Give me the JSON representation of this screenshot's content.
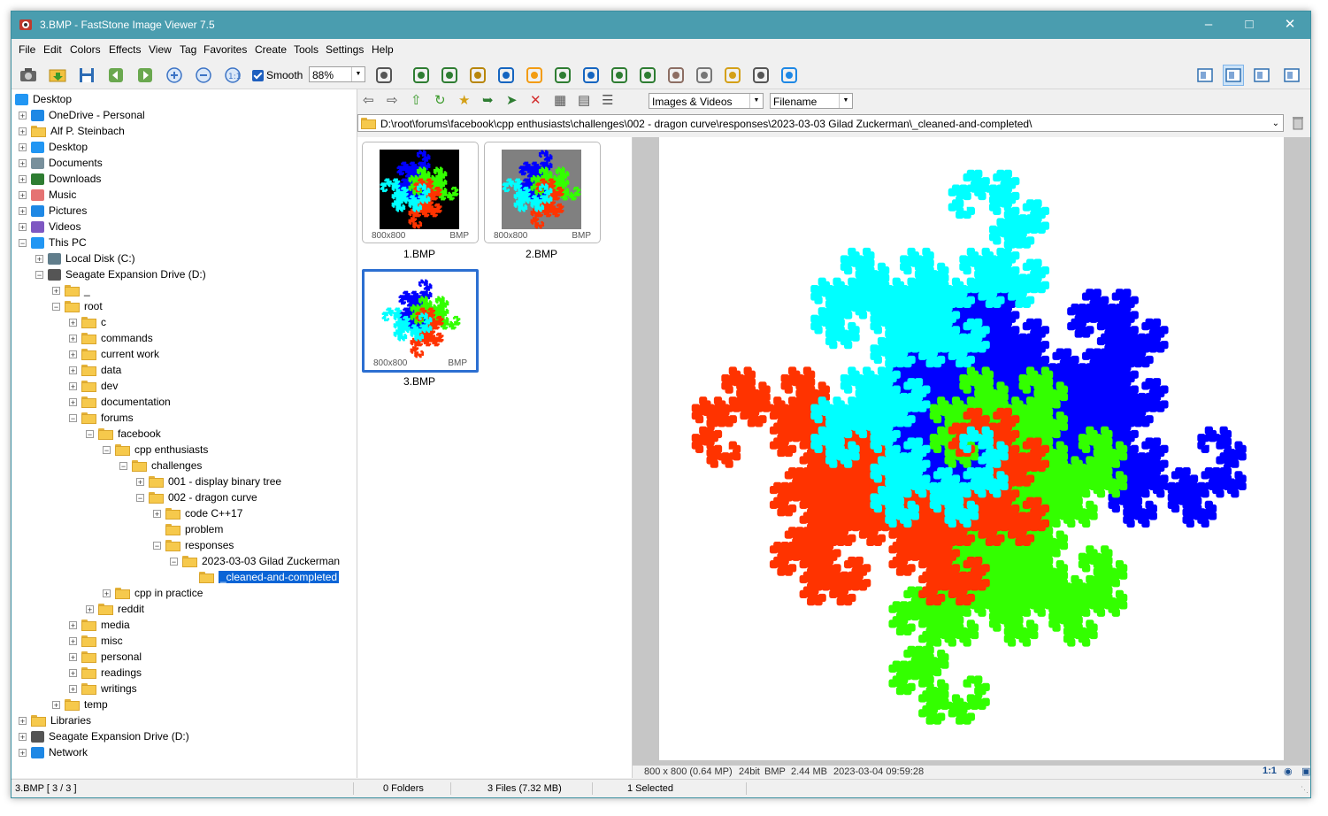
{
  "window": {
    "title": "3.BMP  -  FastStone Image Viewer 7.5"
  },
  "menu": [
    "File",
    "Edit",
    "Colors",
    "Effects",
    "View",
    "Tag",
    "Favorites",
    "Create",
    "Tools",
    "Settings",
    "Help"
  ],
  "toolbar": {
    "smooth_label": "Smooth",
    "zoom_value": "88%",
    "left_icons": [
      "camera-icon",
      "open-folder-icon",
      "save-icon",
      "back-icon",
      "forward-icon",
      "zoom-in-icon",
      "zoom-out-icon",
      "actual-size-icon"
    ],
    "right_icons": [
      "selection-icon",
      "compare-icon",
      "image-upload-icon",
      "crop-icon",
      "resize-icon",
      "color-adjust-icon",
      "face-icon",
      "rotate-left-icon",
      "rotate-right-icon",
      "sharpen-icon",
      "frame-icon",
      "draw-icon",
      "email-icon",
      "print-icon",
      "wallpaper-icon"
    ],
    "layout_icons": [
      "layout-grid-icon",
      "layout-split-icon",
      "layout-full-icon",
      "fullscreen-icon"
    ]
  },
  "nav": {
    "filter_value": "Images & Videos",
    "sort_value": "Filename",
    "path": "D:\\root\\forums\\facebook\\cpp enthusiasts\\challenges\\002 - dragon curve\\responses\\2023-03-03 Gilad Zuckerman\\_cleaned-and-completed\\"
  },
  "tree": [
    {
      "label": "Desktop",
      "level": 0,
      "icon": "desktop-icon",
      "exp": ""
    },
    {
      "label": "OneDrive - Personal",
      "level": 1,
      "icon": "cloud-icon",
      "exp": "+"
    },
    {
      "label": "Alf P. Steinbach",
      "level": 1,
      "icon": "folder-icon",
      "exp": "+"
    },
    {
      "label": "Desktop",
      "level": 1,
      "icon": "desktop-icon",
      "exp": "+"
    },
    {
      "label": "Documents",
      "level": 1,
      "icon": "documents-icon",
      "exp": "+"
    },
    {
      "label": "Downloads",
      "level": 1,
      "icon": "download-icon",
      "exp": "+"
    },
    {
      "label": "Music",
      "level": 1,
      "icon": "music-icon",
      "exp": "+"
    },
    {
      "label": "Pictures",
      "level": 1,
      "icon": "pictures-icon",
      "exp": "+"
    },
    {
      "label": "Videos",
      "level": 1,
      "icon": "videos-icon",
      "exp": "+"
    },
    {
      "label": "This PC",
      "level": 1,
      "icon": "pc-icon",
      "exp": "-"
    },
    {
      "label": "Local Disk (C:)",
      "level": 2,
      "icon": "disk-icon",
      "exp": "+"
    },
    {
      "label": "Seagate Expansion Drive (D:)",
      "level": 2,
      "icon": "drive-icon",
      "exp": "-"
    },
    {
      "label": "_",
      "level": 3,
      "icon": "folder-icon",
      "exp": "+"
    },
    {
      "label": "root",
      "level": 3,
      "icon": "folder-icon",
      "exp": "-"
    },
    {
      "label": "c",
      "level": 4,
      "icon": "folder-icon",
      "exp": "+"
    },
    {
      "label": "commands",
      "level": 4,
      "icon": "folder-icon",
      "exp": "+"
    },
    {
      "label": "current work",
      "level": 4,
      "icon": "folder-icon",
      "exp": "+"
    },
    {
      "label": "data",
      "level": 4,
      "icon": "folder-icon",
      "exp": "+"
    },
    {
      "label": "dev",
      "level": 4,
      "icon": "folder-icon",
      "exp": "+"
    },
    {
      "label": "documentation",
      "level": 4,
      "icon": "folder-icon",
      "exp": "+"
    },
    {
      "label": "forums",
      "level": 4,
      "icon": "folder-icon",
      "exp": "-"
    },
    {
      "label": "facebook",
      "level": 5,
      "icon": "folder-icon",
      "exp": "-"
    },
    {
      "label": "cpp enthusiasts",
      "level": 6,
      "icon": "folder-icon",
      "exp": "-"
    },
    {
      "label": "challenges",
      "level": 7,
      "icon": "folder-icon",
      "exp": "-"
    },
    {
      "label": "001 - display binary tree",
      "level": 8,
      "icon": "folder-icon",
      "exp": "+"
    },
    {
      "label": "002 - dragon curve",
      "level": 8,
      "icon": "folder-icon",
      "exp": "-"
    },
    {
      "label": "code C++17",
      "level": 9,
      "icon": "folder-icon",
      "exp": "+"
    },
    {
      "label": "problem",
      "level": 9,
      "icon": "folder-icon",
      "exp": ""
    },
    {
      "label": "responses",
      "level": 9,
      "icon": "folder-icon",
      "exp": "-"
    },
    {
      "label": "2023-03-03 Gilad Zuckerman",
      "level": 10,
      "icon": "folder-icon",
      "exp": "-"
    },
    {
      "label": "_cleaned-and-completed",
      "level": 11,
      "icon": "folder-icon",
      "exp": "",
      "selected": true
    },
    {
      "label": "cpp in practice",
      "level": 6,
      "icon": "folder-icon",
      "exp": "+"
    },
    {
      "label": "reddit",
      "level": 5,
      "icon": "folder-icon",
      "exp": "+"
    },
    {
      "label": "media",
      "level": 4,
      "icon": "folder-icon",
      "exp": "+"
    },
    {
      "label": "misc",
      "level": 4,
      "icon": "folder-icon",
      "exp": "+"
    },
    {
      "label": "personal",
      "level": 4,
      "icon": "folder-icon",
      "exp": "+"
    },
    {
      "label": "readings",
      "level": 4,
      "icon": "folder-icon",
      "exp": "+"
    },
    {
      "label": "writings",
      "level": 4,
      "icon": "folder-icon",
      "exp": "+"
    },
    {
      "label": "temp",
      "level": 3,
      "icon": "folder-icon",
      "exp": "+"
    },
    {
      "label": "Libraries",
      "level": 1,
      "icon": "folder-icon",
      "exp": "+"
    },
    {
      "label": "Seagate Expansion Drive (D:)",
      "level": 1,
      "icon": "drive-icon",
      "exp": "+"
    },
    {
      "label": "Network",
      "level": 1,
      "icon": "network-icon",
      "exp": "+"
    }
  ],
  "thumbnails": [
    {
      "name": "1.BMP",
      "dims": "800x800",
      "ext": "BMP",
      "bg": "#000000",
      "selected": false
    },
    {
      "name": "2.BMP",
      "dims": "800x800",
      "ext": "BMP",
      "bg": "#808080",
      "selected": false
    },
    {
      "name": "3.BMP",
      "dims": "800x800",
      "ext": "BMP",
      "bg": "#ffffff",
      "selected": true
    }
  ],
  "image_info": {
    "dimensions": "800 x 800 (0.64 MP)",
    "depth": "24bit",
    "format": "BMP",
    "size": "2.44 MB",
    "date": "2023-03-04 09:59:28",
    "zoom_label": "1:1"
  },
  "status": {
    "file": "3.BMP [ 3 / 3 ]",
    "folders": "0 Folders",
    "files": "3 Files (7.32 MB)",
    "selected": "1 Selected"
  },
  "colors": {
    "titlebar": "#4a9daf",
    "selection": "#0a64d6",
    "dragon_blue": "#0000ff",
    "dragon_green": "#33ff00",
    "dragon_red": "#ff3300",
    "dragon_cyan": "#00ffff"
  }
}
